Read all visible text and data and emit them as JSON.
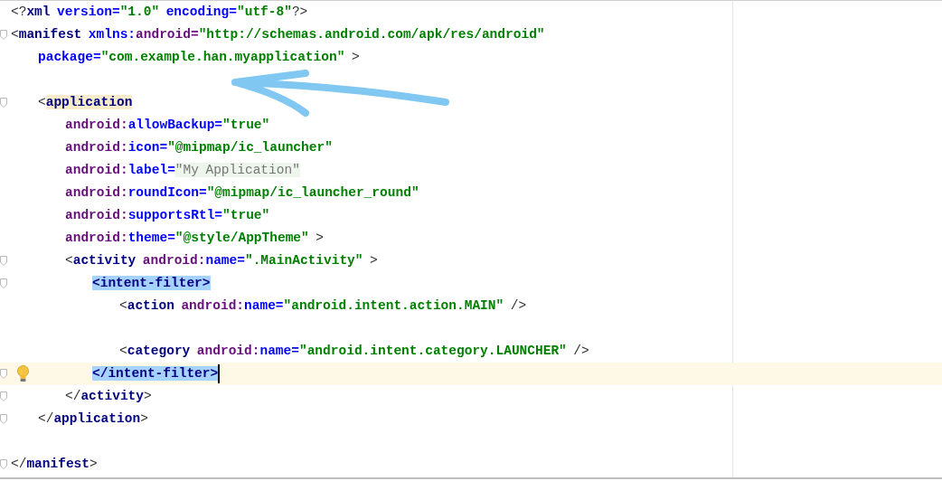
{
  "editor": {
    "lines": [
      {
        "tokens": [
          {
            "text": "<?",
            "kind": "punct"
          },
          {
            "text": "xml",
            "kind": "tag"
          },
          {
            "text": " version=",
            "kind": "attr"
          },
          {
            "text": "\"1.0\"",
            "kind": "value"
          },
          {
            "text": " encoding=",
            "kind": "attr"
          },
          {
            "text": "\"utf-8\"",
            "kind": "value"
          },
          {
            "text": "?>",
            "kind": "punct"
          }
        ]
      },
      {
        "fold": true,
        "tokens": [
          {
            "text": "<",
            "kind": "punct"
          },
          {
            "text": "manifest",
            "kind": "tag"
          },
          {
            "text": " xmlns:",
            "kind": "attr"
          },
          {
            "text": "android=",
            "kind": "ns"
          },
          {
            "text": "\"http://schemas.android.com/apk/res/android\"",
            "kind": "value"
          }
        ]
      },
      {
        "tokens": [
          {
            "text": "    package=",
            "kind": "attr"
          },
          {
            "text": "\"com.example.han.myapplication\"",
            "kind": "value"
          },
          {
            "text": " >",
            "kind": "punct"
          }
        ]
      },
      {
        "blank_before": true,
        "fold": true,
        "tokens": [
          {
            "text": "    <",
            "kind": "punct"
          },
          {
            "text": "application",
            "kind": "tag",
            "matched": true
          }
        ]
      },
      {
        "tokens": [
          {
            "text": "        android:",
            "kind": "ns"
          },
          {
            "text": "allowBackup=",
            "kind": "attr"
          },
          {
            "text": "\"true\"",
            "kind": "value"
          }
        ]
      },
      {
        "tokens": [
          {
            "text": "        android:",
            "kind": "ns"
          },
          {
            "text": "icon=",
            "kind": "attr"
          },
          {
            "text": "\"@mipmap/ic_launcher\"",
            "kind": "value"
          }
        ]
      },
      {
        "tokens": [
          {
            "text": "        android:",
            "kind": "ns"
          },
          {
            "text": "label=",
            "kind": "attr"
          },
          {
            "text": "\"My Application\"",
            "kind": "folded"
          }
        ]
      },
      {
        "tokens": [
          {
            "text": "        android:",
            "kind": "ns"
          },
          {
            "text": "roundIcon=",
            "kind": "attr"
          },
          {
            "text": "\"@mipmap/ic_launcher_round\"",
            "kind": "value"
          }
        ]
      },
      {
        "tokens": [
          {
            "text": "        android:",
            "kind": "ns"
          },
          {
            "text": "supportsRtl=",
            "kind": "attr"
          },
          {
            "text": "\"true\"",
            "kind": "value"
          }
        ]
      },
      {
        "tokens": [
          {
            "text": "        android:",
            "kind": "ns"
          },
          {
            "text": "theme=",
            "kind": "attr"
          },
          {
            "text": "\"@style/AppTheme\"",
            "kind": "value"
          },
          {
            "text": " >",
            "kind": "punct"
          }
        ]
      },
      {
        "fold": true,
        "tokens": [
          {
            "text": "        <",
            "kind": "punct"
          },
          {
            "text": "activity",
            "kind": "tag"
          },
          {
            "text": " android:",
            "kind": "ns"
          },
          {
            "text": "name=",
            "kind": "attr"
          },
          {
            "text": "\".MainActivity\"",
            "kind": "value"
          },
          {
            "text": " >",
            "kind": "punct"
          }
        ]
      },
      {
        "fold": true,
        "tokens": [
          {
            "text": "            <intent-filter>",
            "kind": "tag",
            "selected": true
          }
        ]
      },
      {
        "tokens": [
          {
            "text": "                <",
            "kind": "punct"
          },
          {
            "text": "action",
            "kind": "tag"
          },
          {
            "text": " android:",
            "kind": "ns"
          },
          {
            "text": "name=",
            "kind": "attr"
          },
          {
            "text": "\"android.intent.action.MAIN\"",
            "kind": "value"
          },
          {
            "text": " />",
            "kind": "punct"
          }
        ]
      },
      {
        "blank_before": true,
        "tokens": [
          {
            "text": "                <",
            "kind": "punct"
          },
          {
            "text": "category",
            "kind": "tag"
          },
          {
            "text": " android:",
            "kind": "ns"
          },
          {
            "text": "name=",
            "kind": "attr"
          },
          {
            "text": "\"android.intent.category.LAUNCHER\"",
            "kind": "value"
          },
          {
            "text": " />",
            "kind": "punct"
          }
        ]
      },
      {
        "fold": true,
        "current": true,
        "caret": true,
        "tokens": [
          {
            "text": "            </intent-filter>",
            "kind": "tag",
            "selected": true
          }
        ]
      },
      {
        "fold": true,
        "tokens": [
          {
            "text": "        </",
            "kind": "punct"
          },
          {
            "text": "activity",
            "kind": "tag"
          },
          {
            "text": ">",
            "kind": "punct"
          }
        ]
      },
      {
        "fold": true,
        "tokens": [
          {
            "text": "    </",
            "kind": "punct"
          },
          {
            "text": "application",
            "kind": "tag"
          },
          {
            "text": ">",
            "kind": "punct"
          }
        ]
      },
      {
        "blank_before": true,
        "fold": true,
        "tokens": [
          {
            "text": "</",
            "kind": "punct"
          },
          {
            "text": "manifest",
            "kind": "tag"
          },
          {
            "text": ">",
            "kind": "punct"
          }
        ]
      }
    ]
  }
}
